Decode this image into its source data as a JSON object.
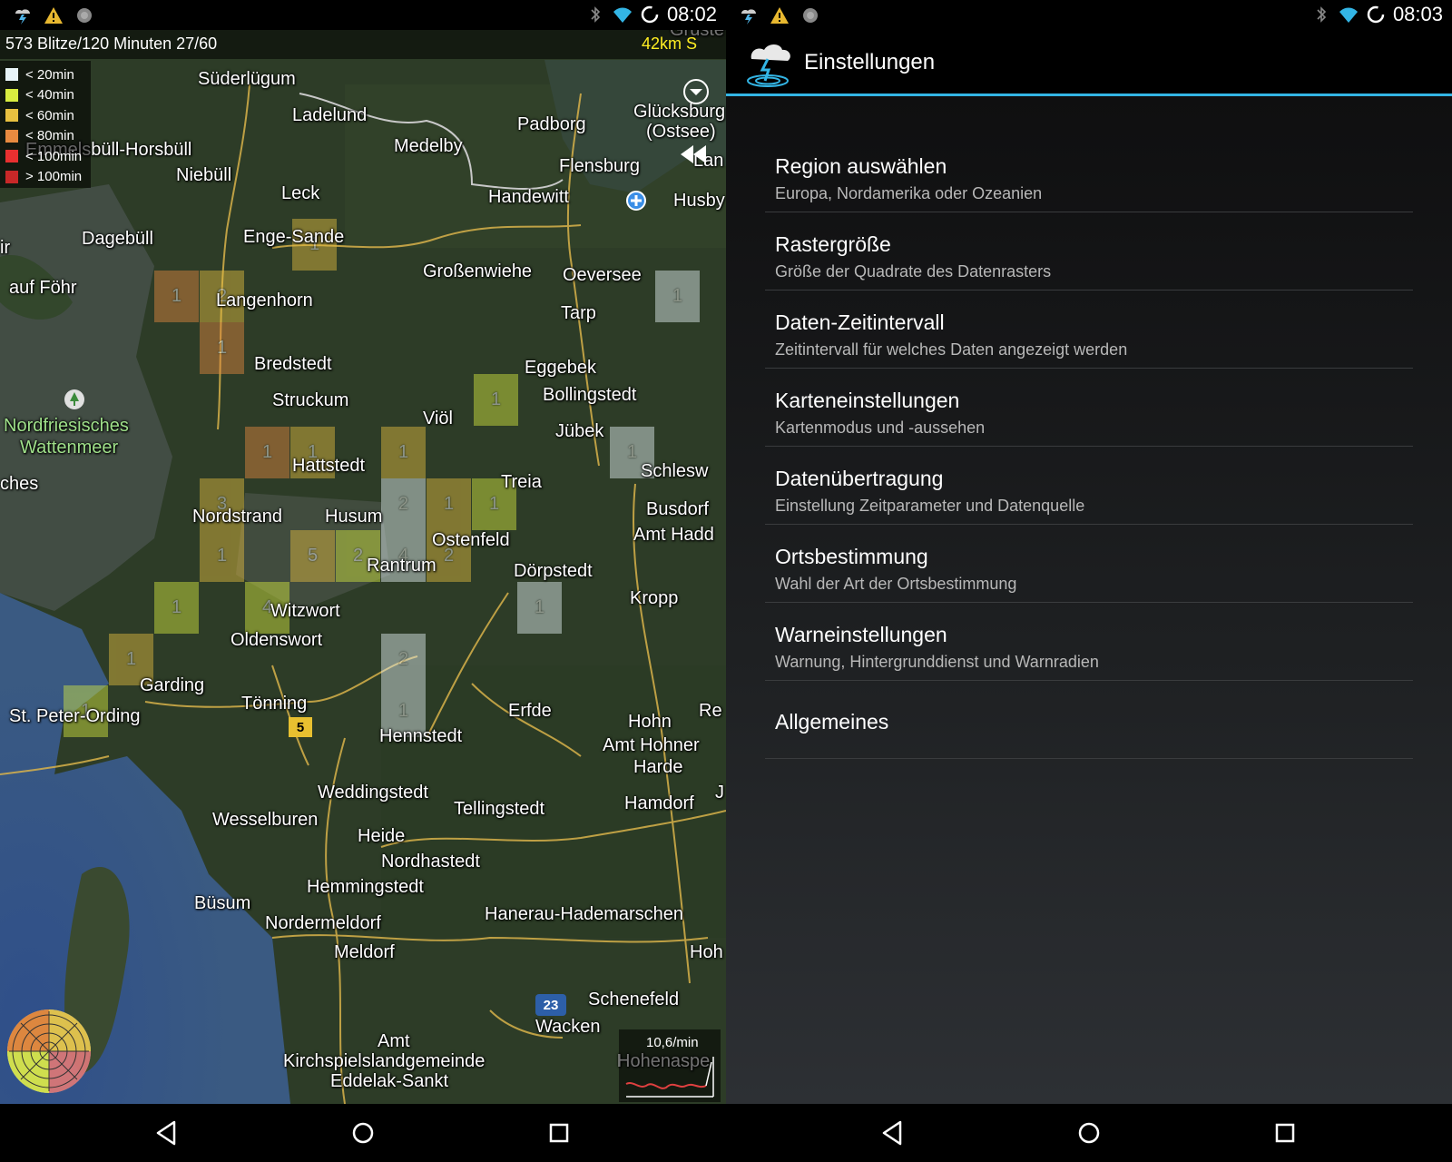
{
  "left_screen": {
    "status_bar": {
      "time": "08:02",
      "icons": [
        "lightning-app-icon",
        "warning-icon",
        "circle-icon",
        "bluetooth-icon",
        "wifi-icon",
        "sync-icon"
      ]
    },
    "map": {
      "summary": "573 Blitze/120 Minuten 27/60",
      "range": "42km S",
      "legend": [
        {
          "label": "< 20min",
          "color": "#e8f4f8"
        },
        {
          "label": "< 40min",
          "color": "#d8ec40"
        },
        {
          "label": "< 60min",
          "color": "#e8c040"
        },
        {
          "label": "< 80min",
          "color": "#e88a40"
        },
        {
          "label": "< 100min",
          "color": "#e83030"
        },
        {
          "label": "> 100min",
          "color": "#c82828"
        }
      ],
      "places": [
        "Süderlügum",
        "Ladelund",
        "Medelby",
        "Padborg",
        "Glücksburg",
        "(Ostsee)",
        "Flensburg",
        "Lan",
        "Emmelsbüll-Horsbüll",
        "Niebüll",
        "Leck",
        "Handewitt",
        "Husby",
        "Dagebüll",
        "Enge-Sande",
        "Großenwiehe",
        "Oeversee",
        "auf Föhr",
        "Langenhorn",
        "Tarp",
        "Bredstedt",
        "Eggebek",
        "Struckum",
        "Bollingstedt",
        "Nordfriesisches",
        "Wattenmeer",
        "Viöl",
        "Jübek",
        "ches",
        "Hattstedt",
        "Schlesw",
        "Treia",
        "Nordstrand",
        "Husum",
        "Busdorf",
        "Ostenfeld",
        "Amt Hadd",
        "Rantrum",
        "Dörpstedt",
        "Kropp",
        "Witzwort",
        "Oldenswort",
        "Garding",
        "St. Peter-Ording",
        "Tönning",
        "Erfde",
        "Hohn",
        "Re",
        "Hennstedt",
        "Amt Hohner",
        "Harde",
        "Weddingstedt",
        "Tellingstedt",
        "Hamdorf",
        "J",
        "Wesselburen",
        "Heide",
        "Nordhastedt",
        "Hemmingstedt",
        "Büsum",
        "Hanerau-Hademarschen",
        "Nordermeldorf",
        "Meldorf",
        "Hoh",
        "Schenefeld",
        "Wacken",
        "Amt",
        "Kirchspielslandgemeinde",
        "Eddelak-Sankt",
        "Hohenaspe",
        "Gruste",
        "ir"
      ],
      "cells": [
        {
          "count": "1",
          "color": "#e8c040"
        },
        {
          "count": "1",
          "color": "#e88a40"
        },
        {
          "count": "2",
          "color": "#e8c040"
        },
        {
          "count": "1",
          "color": "#e88a40"
        },
        {
          "count": "1",
          "color": "#e8f4f8"
        },
        {
          "count": "1",
          "color": "#d8ec40"
        },
        {
          "count": "1",
          "color": "#e88a40"
        },
        {
          "count": "1",
          "color": "#e8c040"
        },
        {
          "count": "1",
          "color": "#e8c040"
        },
        {
          "count": "1",
          "color": "#e8f4f8"
        },
        {
          "count": "3",
          "color": "#e8c040"
        },
        {
          "count": "2",
          "color": "#e8f4f8"
        },
        {
          "count": "1",
          "color": "#e8c040"
        },
        {
          "count": "1",
          "color": "#d8ec40"
        },
        {
          "count": "1",
          "color": "#e8c040"
        },
        {
          "count": "5",
          "color": "#e8c040"
        },
        {
          "count": "2",
          "color": "#d8ec40"
        },
        {
          "count": "4",
          "color": "#e8f4f8"
        },
        {
          "count": "2",
          "color": "#e8c040"
        },
        {
          "count": "1",
          "color": "#e8f4f8"
        },
        {
          "count": "1",
          "color": "#d8ec40"
        },
        {
          "count": "4",
          "color": "#d8ec40"
        },
        {
          "count": "1",
          "color": "#e8c040"
        },
        {
          "count": "2",
          "color": "#e8f4f8"
        },
        {
          "count": "1",
          "color": "#d8ec40"
        },
        {
          "count": "1",
          "color": "#e8f4f8"
        }
      ],
      "road_badges": [
        "5",
        "23"
      ],
      "rate": "10,6/min"
    }
  },
  "right_screen": {
    "status_bar": {
      "time": "08:03"
    },
    "action_bar": {
      "title": "Einstellungen"
    },
    "preferences": [
      {
        "title": "Region auswählen",
        "summary": "Europa, Nordamerika oder Ozeanien"
      },
      {
        "title": "Rastergröße",
        "summary": "Größe der Quadrate des Datenrasters"
      },
      {
        "title": "Daten-Zeitintervall",
        "summary": "Zeitintervall für welches Daten angezeigt werden"
      },
      {
        "title": "Karteneinstellungen",
        "summary": "Kartenmodus und -aussehen"
      },
      {
        "title": "Datenübertragung",
        "summary": "Einstellung Zeitparameter und Datenquelle"
      },
      {
        "title": "Ortsbestimmung",
        "summary": "Wahl der Art der Ortsbestimmung"
      },
      {
        "title": "Warneinstellungen",
        "summary": "Warnung, Hintergrunddienst und Warnradien"
      },
      {
        "title": "Allgemeines",
        "summary": ""
      }
    ]
  }
}
